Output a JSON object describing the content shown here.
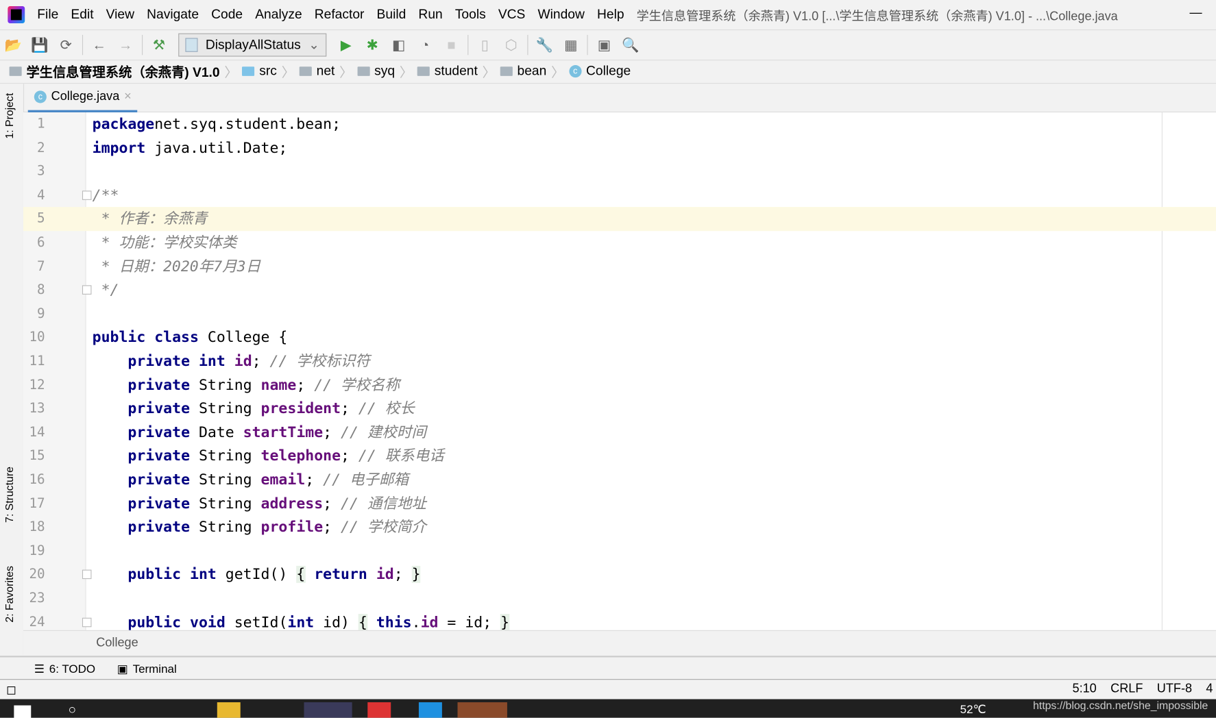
{
  "window": {
    "title": "学生信息管理系统（余燕青) V1.0 [...\\学生信息管理系统（余燕青) V1.0] - ...\\College.java",
    "minimize": "—"
  },
  "menu": [
    "File",
    "Edit",
    "View",
    "Navigate",
    "Code",
    "Analyze",
    "Refactor",
    "Build",
    "Run",
    "Tools",
    "VCS",
    "Window",
    "Help"
  ],
  "toolbar": {
    "run_config": "DisplayAllStatus"
  },
  "breadcrumb": [
    "学生信息管理系统（余燕青) V1.0",
    "src",
    "net",
    "syq",
    "student",
    "bean",
    "College"
  ],
  "sidebar": {
    "project": "1: Project",
    "structure": "7: Structure",
    "favorites": "2: Favorites"
  },
  "tab": {
    "label": "College.java"
  },
  "code": [
    {
      "n": "1",
      "t": [
        [
          "kw",
          "package"
        ],
        [
          "",
          "net.syq.student.bean;"
        ]
      ]
    },
    {
      "n": "2",
      "t": [
        [
          "kw",
          "import"
        ],
        [
          "",
          " java.util.Date;"
        ]
      ]
    },
    {
      "n": "3",
      "t": []
    },
    {
      "n": "4",
      "t": [
        [
          "cm",
          "/**"
        ]
      ]
    },
    {
      "n": "5",
      "t": [
        [
          "cm",
          " * 作者：余燕青"
        ]
      ]
    },
    {
      "n": "6",
      "t": [
        [
          "cm",
          " * 功能：学校实体类"
        ]
      ]
    },
    {
      "n": "7",
      "t": [
        [
          "cm",
          " * 日期：2020年7月3日"
        ]
      ]
    },
    {
      "n": "8",
      "t": [
        [
          "cm",
          " */"
        ]
      ]
    },
    {
      "n": "9",
      "t": []
    },
    {
      "n": "10",
      "t": [
        [
          "kw",
          "public class"
        ],
        [
          "",
          " College {"
        ]
      ]
    },
    {
      "n": "11",
      "t": [
        [
          "",
          "    "
        ],
        [
          "kw",
          "private int"
        ],
        [
          "",
          " "
        ],
        [
          "fd",
          "id"
        ],
        [
          "",
          "; "
        ],
        [
          "cm",
          "// 学校标识符"
        ]
      ]
    },
    {
      "n": "12",
      "t": [
        [
          "",
          "    "
        ],
        [
          "kw",
          "private"
        ],
        [
          "",
          " String "
        ],
        [
          "fd",
          "name"
        ],
        [
          "",
          "; "
        ],
        [
          "cm",
          "// 学校名称"
        ]
      ]
    },
    {
      "n": "13",
      "t": [
        [
          "",
          "    "
        ],
        [
          "kw",
          "private"
        ],
        [
          "",
          " String "
        ],
        [
          "fd",
          "president"
        ],
        [
          "",
          "; "
        ],
        [
          "cm",
          "// 校长"
        ]
      ]
    },
    {
      "n": "14",
      "t": [
        [
          "",
          "    "
        ],
        [
          "kw",
          "private"
        ],
        [
          "",
          " Date "
        ],
        [
          "fd",
          "startTime"
        ],
        [
          "",
          "; "
        ],
        [
          "cm",
          "// 建校时间"
        ]
      ]
    },
    {
      "n": "15",
      "t": [
        [
          "",
          "    "
        ],
        [
          "kw",
          "private"
        ],
        [
          "",
          " String "
        ],
        [
          "fd",
          "telephone"
        ],
        [
          "",
          "; "
        ],
        [
          "cm",
          "// 联系电话"
        ]
      ]
    },
    {
      "n": "16",
      "t": [
        [
          "",
          "    "
        ],
        [
          "kw",
          "private"
        ],
        [
          "",
          " String "
        ],
        [
          "fd",
          "email"
        ],
        [
          "",
          "; "
        ],
        [
          "cm",
          "// 电子邮箱"
        ]
      ]
    },
    {
      "n": "17",
      "t": [
        [
          "",
          "    "
        ],
        [
          "kw",
          "private"
        ],
        [
          "",
          " String "
        ],
        [
          "fd",
          "address"
        ],
        [
          "",
          "; "
        ],
        [
          "cm",
          "// 通信地址"
        ]
      ]
    },
    {
      "n": "18",
      "t": [
        [
          "",
          "    "
        ],
        [
          "kw",
          "private"
        ],
        [
          "",
          " String "
        ],
        [
          "fd",
          "profile"
        ],
        [
          "",
          "; "
        ],
        [
          "cm",
          "// 学校简介"
        ]
      ]
    },
    {
      "n": "19",
      "t": []
    },
    {
      "n": "20",
      "t": [
        [
          "",
          "    "
        ],
        [
          "kw",
          "public int"
        ],
        [
          "",
          " getId() "
        ],
        [
          "br",
          "{"
        ],
        [
          "",
          " "
        ],
        [
          "kw",
          "return"
        ],
        [
          "",
          " "
        ],
        [
          "fd",
          "id"
        ],
        [
          "",
          "; "
        ],
        [
          "br",
          "}"
        ]
      ]
    },
    {
      "n": "23",
      "t": []
    },
    {
      "n": "24",
      "t": [
        [
          "",
          "    "
        ],
        [
          "kw",
          "public void"
        ],
        [
          "",
          " setId("
        ],
        [
          "kw",
          "int"
        ],
        [
          "",
          " id) "
        ],
        [
          "br",
          "{"
        ],
        [
          "",
          " "
        ],
        [
          "kw",
          "this"
        ],
        [
          "",
          "."
        ],
        [
          "fd",
          "id"
        ],
        [
          "",
          " = id; "
        ],
        [
          "br",
          "}"
        ]
      ]
    }
  ],
  "current_line": "5",
  "structure_crumb": "College",
  "toolwindows": {
    "todo": "6: TODO",
    "terminal": "Terminal"
  },
  "status": {
    "position": "5:10",
    "line_sep": "CRLF",
    "encoding": "UTF-8",
    "indent": "4"
  },
  "taskbar": {
    "temperature": "52℃",
    "watermark": "https://blog.csdn.net/she_impossible"
  }
}
